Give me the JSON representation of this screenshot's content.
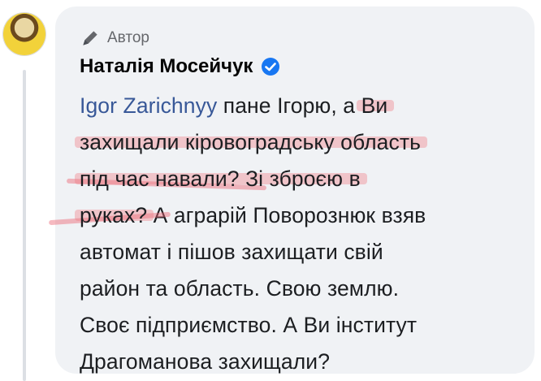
{
  "author_badge": {
    "label": "Автор",
    "icon": "pen-icon"
  },
  "commenter": {
    "name": "Наталія Мосейчук",
    "verified_icon": "verified-badge-icon"
  },
  "comment": {
    "mention": "Igor Zarichnyy",
    "line1_rest": " пане Ігорю, а ",
    "line1_hl": "Ви",
    "line2_hl": "захищали кіровоградську область",
    "line3_hl": "під час навали? Зі зброєю в",
    "line4_hl": "руках?",
    "line4_rest": " А аграрій Поворознюк взяв",
    "line5": "автомат і пішов захищати свій",
    "line6": "район та область. Свою землю.",
    "line7": "Своє підприємство. А Ви інститут",
    "line8": "Драгоманова захищали?"
  },
  "colors": {
    "bubble": "#f0f2f5",
    "mention": "#385898",
    "highlight": "#f07882",
    "verified": "#1877f2"
  }
}
